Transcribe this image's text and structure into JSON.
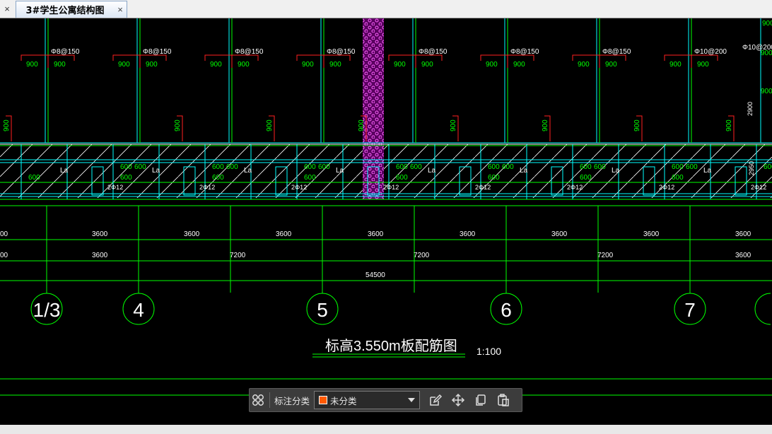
{
  "tabbar": {
    "close_glyph": "×",
    "tab_title": "3#学生公寓结构图",
    "tab_close_glyph": "×"
  },
  "drawing": {
    "rebar_labels": [
      "Φ8@150",
      "Φ8@150",
      "Φ8@150",
      "Φ8@150",
      "Φ8@150",
      "Φ8@150",
      "Φ8@150",
      "Φ10@200",
      "Φ10@200"
    ],
    "top_spacing_label": "900",
    "side_label_900": "900",
    "slab_label_600": "600",
    "la_label": "La",
    "small_bar_label": "2Φ12",
    "dim_row1": [
      "00",
      "3600",
      "3600",
      "3600",
      "3600",
      "3600",
      "3600",
      "3600",
      "3600"
    ],
    "dim_row2": [
      "00",
      "3600",
      "7200",
      "7200",
      "7200",
      "3600"
    ],
    "dim_total": "54500",
    "axis_bubbles": [
      "1/3",
      "4",
      "5",
      "6",
      "7"
    ],
    "right_dims": [
      "2900",
      "2950"
    ],
    "title": "标高3.550m板配筋图",
    "scale": "1:100",
    "colors": {
      "green": "#00ff00",
      "red": "#ff2020",
      "cyan": "#00ffff",
      "magenta": "#ff00ff",
      "white": "#ffffff"
    }
  },
  "toolbar": {
    "label": "标注分类",
    "select_value": "未分类",
    "swatch_color": "#ff5a00"
  }
}
